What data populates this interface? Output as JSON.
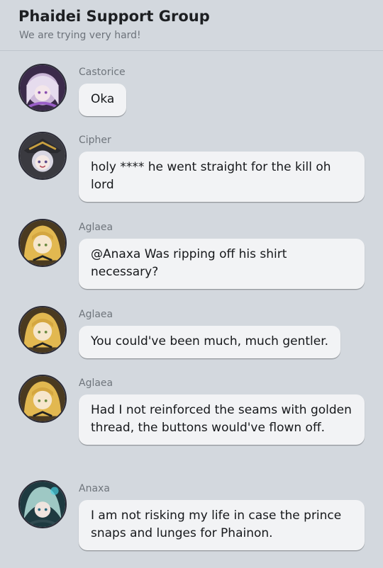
{
  "header": {
    "title": "Phaidei Support Group",
    "subtitle": "We are trying very hard!"
  },
  "messages": [
    {
      "sender": "Castorice",
      "text": "Oka",
      "avatar": "castorice-avatar"
    },
    {
      "sender": "Cipher",
      "text": "holy **** he went straight for the kill oh lord",
      "avatar": "cipher-avatar"
    },
    {
      "sender": "Aglaea",
      "text": "@Anaxa Was ripping off his shirt necessary?",
      "avatar": "aglaea-avatar"
    },
    {
      "sender": "Aglaea",
      "text": "You could've been much, much gentler.",
      "avatar": "aglaea-avatar"
    },
    {
      "sender": "Aglaea",
      "text": "Had I not reinforced the seams with golden thread, the buttons would've flown off.",
      "avatar": "aglaea-avatar"
    },
    {
      "sender": "Anaxa",
      "text": "I am not risking my life in case the prince snaps and lunges for Phainon.",
      "avatar": "anaxa-avatar"
    }
  ]
}
